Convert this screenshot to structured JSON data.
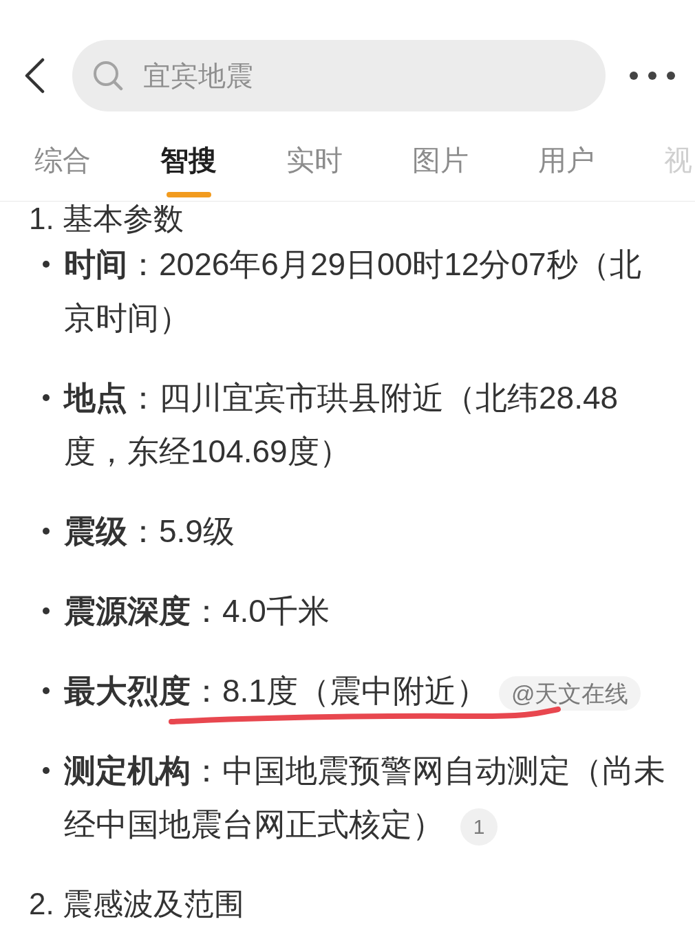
{
  "top_bar": {
    "search": {
      "value": "宜宾地震"
    }
  },
  "tabs": [
    {
      "label": "综合",
      "selected": false
    },
    {
      "label": "智搜",
      "selected": true
    },
    {
      "label": "实时",
      "selected": false
    },
    {
      "label": "图片",
      "selected": false
    },
    {
      "label": "用户",
      "selected": false
    },
    {
      "label": "视",
      "selected": false
    }
  ],
  "sections": [
    {
      "heading": "1. 基本参数",
      "items": [
        {
          "text": "**时间**：2026年6月29日00时12分07秒（北京时间）",
          "underlined": false
        },
        {
          "text": "**地点**：四川宜宾市珙县附近（北纬28.48度，东经104.69度）",
          "underlined": false
        },
        {
          "text": "**震级**：5.9级",
          "underlined": false
        },
        {
          "text": "**震源深度**：4.0千米",
          "underlined": false
        },
        {
          "text": "**最大烈度**：8.1度（震中附近）",
          "underlined": true,
          "badge": {
            "kind": "source",
            "text": "@天文在线"
          }
        },
        {
          "text": "**测定机构**：中国地震预警网自动测定（尚未经中国地震台网正式核定）",
          "underlined": false,
          "badge": {
            "kind": "footnote",
            "text": "1"
          }
        }
      ]
    },
    {
      "heading": "2. 震感波及范围"
    }
  ]
}
